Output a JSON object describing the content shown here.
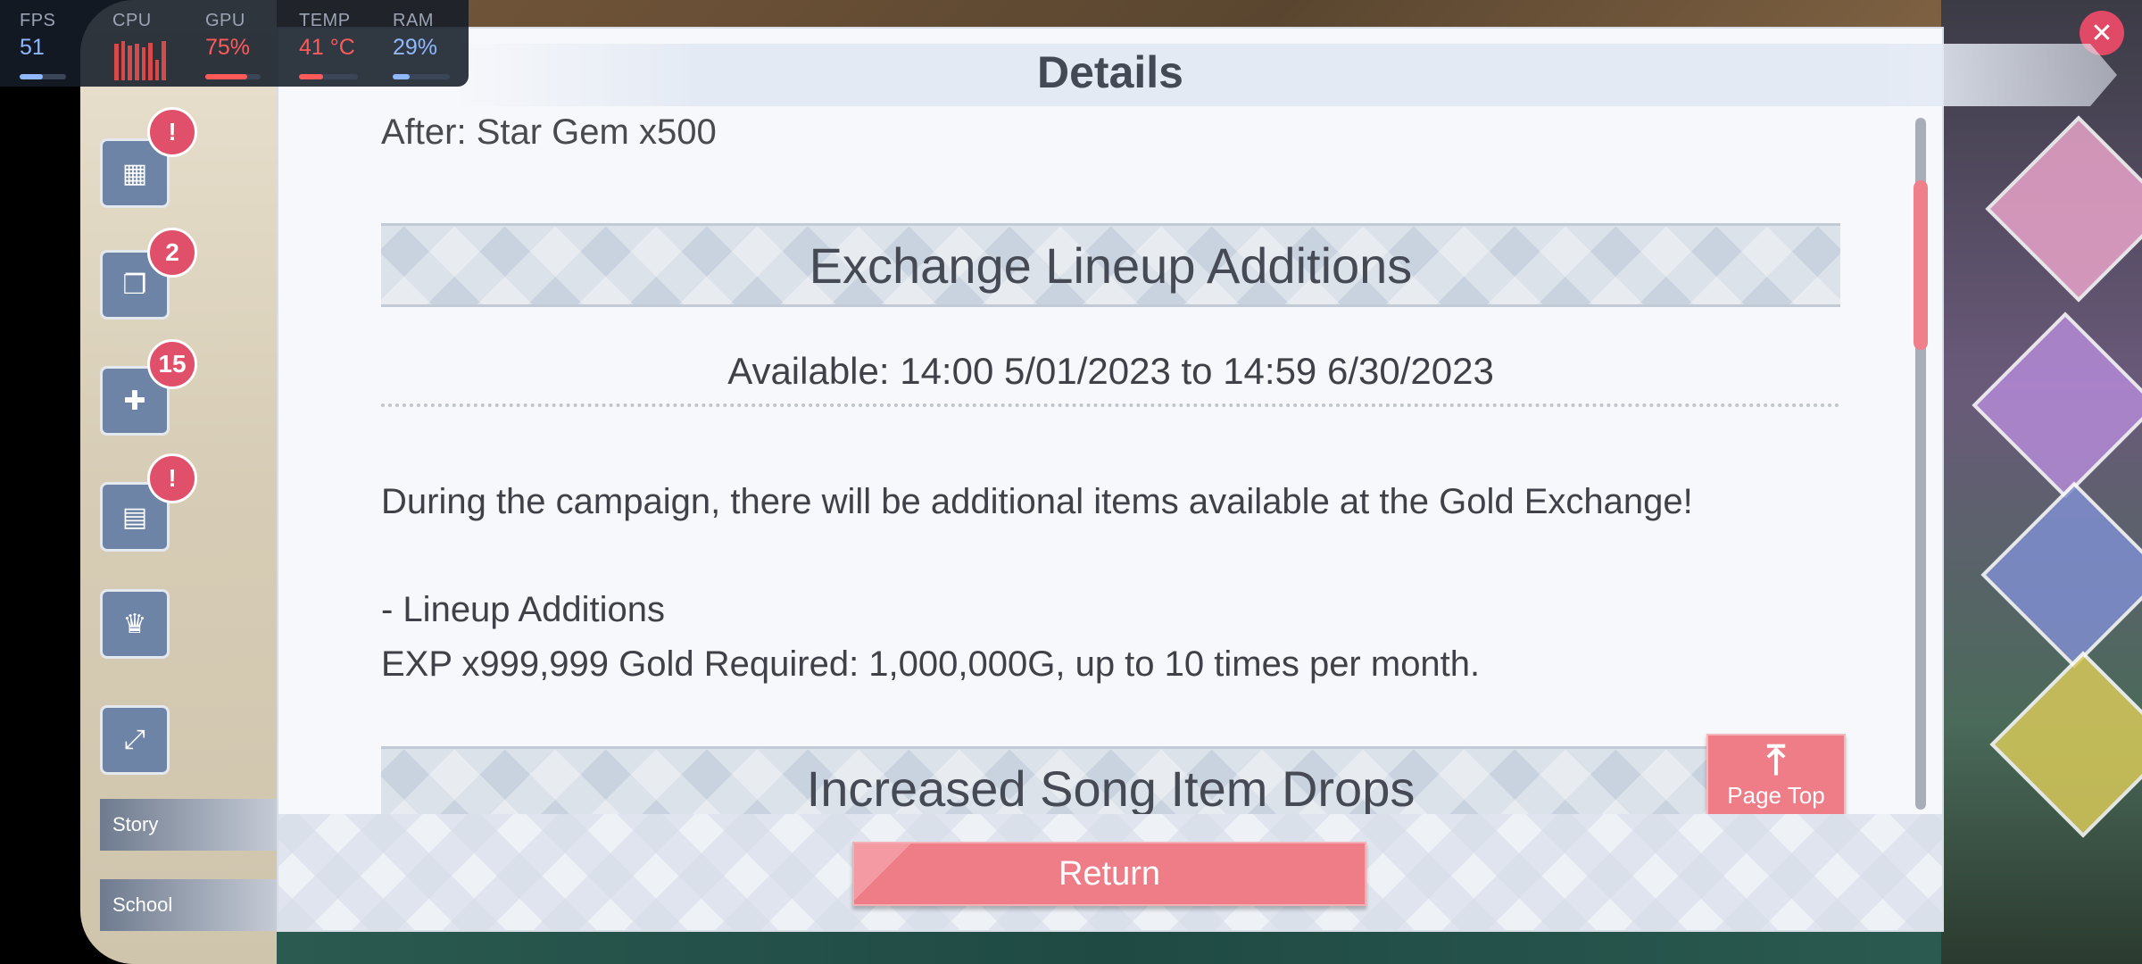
{
  "perf": {
    "fps": {
      "label": "FPS",
      "value": "51",
      "level": 0.5,
      "color": "#8fb8ff"
    },
    "cpu": {
      "label": "CPU",
      "bars": [
        0.9,
        0.95,
        0.85,
        0.9,
        0.8,
        0.92,
        0.5,
        0.95
      ],
      "level": 0.75
    },
    "gpu": {
      "label": "GPU",
      "value": "75%",
      "level": 0.75,
      "color": "#ff5a5a"
    },
    "temp": {
      "label": "TEMP",
      "value": "41 °C",
      "level": 0.41,
      "color": "#ff5a5a"
    },
    "ram": {
      "label": "RAM",
      "value": "29%",
      "level": 0.29,
      "color": "#8fb8ff"
    }
  },
  "dialog": {
    "title": "Details",
    "cut_line": "After: Star Gem x500",
    "section1_title": "Exchange Lineup Additions",
    "available": "Available: 14:00 5/01/2023 to 14:59 6/30/2023",
    "para1": "During the campaign, there will be additional items available at the Gold Exchange!",
    "para2": "- Lineup Additions",
    "para3": "EXP x999,999  Gold Required: 1,000,000G, up to 10 times per month.",
    "section2_title": "Increased Song Item Drops",
    "page_top_label": "Page Top",
    "return_label": "Return",
    "scroll_fraction": 0.12
  },
  "side": {
    "badges": [
      "!",
      "2",
      "15",
      "!"
    ],
    "tabs": [
      "Story",
      "School"
    ]
  }
}
